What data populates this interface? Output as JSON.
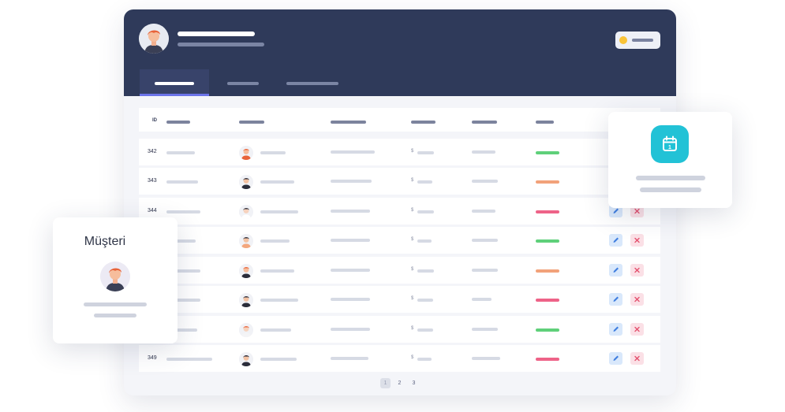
{
  "header": {
    "user_avatar": "person-avatar-icon",
    "status_indicator": "status-dot-icon"
  },
  "tabs": [
    {
      "active": true
    },
    {
      "active": false
    },
    {
      "active": false
    }
  ],
  "table": {
    "id_header": "ID",
    "currency_symbol": "$",
    "rows": [
      {
        "id": "342",
        "status_color": "#5fd07a",
        "has_actions": false
      },
      {
        "id": "343",
        "status_color": "#f2a27a",
        "has_actions": false
      },
      {
        "id": "344",
        "status_color": "#ee6388",
        "has_actions": true
      },
      {
        "id": "",
        "status_color": "#5fd07a",
        "has_actions": true
      },
      {
        "id": "",
        "status_color": "#f2a27a",
        "has_actions": true
      },
      {
        "id": "",
        "status_color": "#ee6388",
        "has_actions": true
      },
      {
        "id": "",
        "status_color": "#5fd07a",
        "has_actions": true
      },
      {
        "id": "349",
        "status_color": "#ee6388",
        "has_actions": true
      }
    ],
    "action_icons": {
      "edit": "pencil-icon",
      "delete": "close-icon"
    }
  },
  "pagination": {
    "pages": [
      "1",
      "2",
      "3"
    ],
    "current": "1"
  },
  "customer_card": {
    "title": "Müşteri",
    "avatar": "person-avatar-icon"
  },
  "calendar_card": {
    "icon": "calendar-icon",
    "icon_day": "1",
    "accent": "#22c2d6"
  }
}
